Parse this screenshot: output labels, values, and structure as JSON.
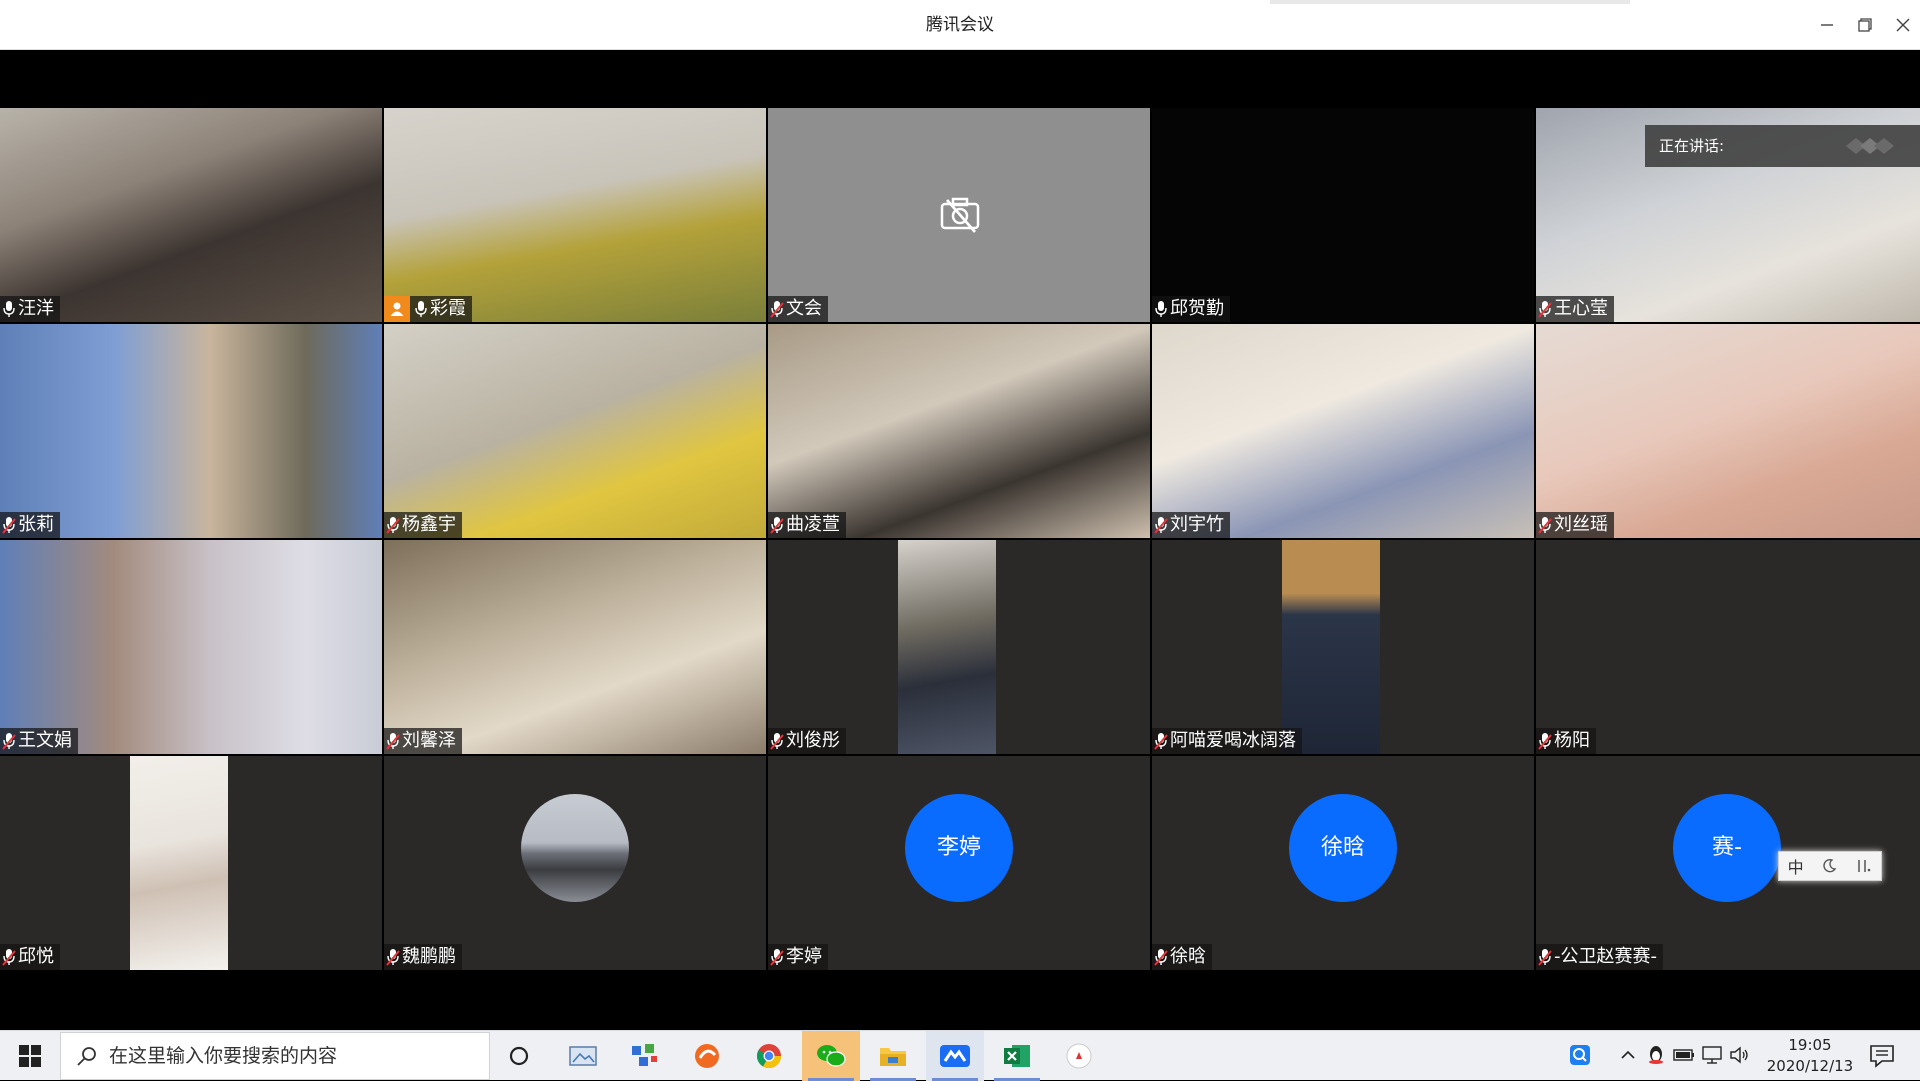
{
  "window": {
    "title": "腾讯会议"
  },
  "speaking": {
    "label": "正在讲话:"
  },
  "participants": [
    {
      "name": "汪洋",
      "muted": false,
      "video": true,
      "host": false
    },
    {
      "name": "彩霞",
      "muted": false,
      "video": true,
      "host": true
    },
    {
      "name": "文会",
      "muted": true,
      "video": false,
      "host": false
    },
    {
      "name": "邱贺勤",
      "muted": false,
      "video": true,
      "host": false
    },
    {
      "name": "王心莹",
      "muted": true,
      "video": true,
      "host": false
    },
    {
      "name": "张莉",
      "muted": true,
      "video": true,
      "host": false
    },
    {
      "name": "杨鑫宇",
      "muted": true,
      "video": true,
      "host": false
    },
    {
      "name": "曲凌萱",
      "muted": true,
      "video": true,
      "host": false
    },
    {
      "name": "刘宇竹",
      "muted": true,
      "video": true,
      "host": false
    },
    {
      "name": "刘丝瑶",
      "muted": true,
      "video": true,
      "host": false
    },
    {
      "name": "王文娟",
      "muted": true,
      "video": true,
      "host": false
    },
    {
      "name": "刘馨泽",
      "muted": true,
      "video": true,
      "host": false
    },
    {
      "name": "刘俊彤",
      "muted": true,
      "video": true,
      "host": false
    },
    {
      "name": "阿喵爱喝冰阔落",
      "muted": true,
      "video": true,
      "host": false
    },
    {
      "name": "杨阳",
      "muted": true,
      "video": true,
      "host": false
    },
    {
      "name": "邱悦",
      "muted": true,
      "video": true,
      "host": false
    },
    {
      "name": "魏鹏鹏",
      "muted": true,
      "video": false,
      "host": false
    },
    {
      "name": "李婷",
      "muted": true,
      "video": false,
      "host": false,
      "avatar_text": "李婷"
    },
    {
      "name": "徐晗",
      "muted": true,
      "video": false,
      "host": false,
      "avatar_text": "徐晗"
    },
    {
      "name": "-公卫赵赛赛-",
      "muted": true,
      "video": false,
      "host": false,
      "avatar_text": "赛-"
    }
  ],
  "ime": {
    "mode": "中"
  },
  "taskbar": {
    "search_placeholder": "在这里输入你要搜索的内容",
    "time": "19:05",
    "date": "2020/12/13",
    "apps": [
      "cortana",
      "photos",
      "tool",
      "firefox-like",
      "chrome",
      "wechat",
      "explorer",
      "tencent-meeting",
      "excel",
      "app"
    ]
  },
  "colors": {
    "accent_avatar": "#0a6cff",
    "host_badge": "#f08a1d",
    "tile_bg": "#2b2927"
  }
}
